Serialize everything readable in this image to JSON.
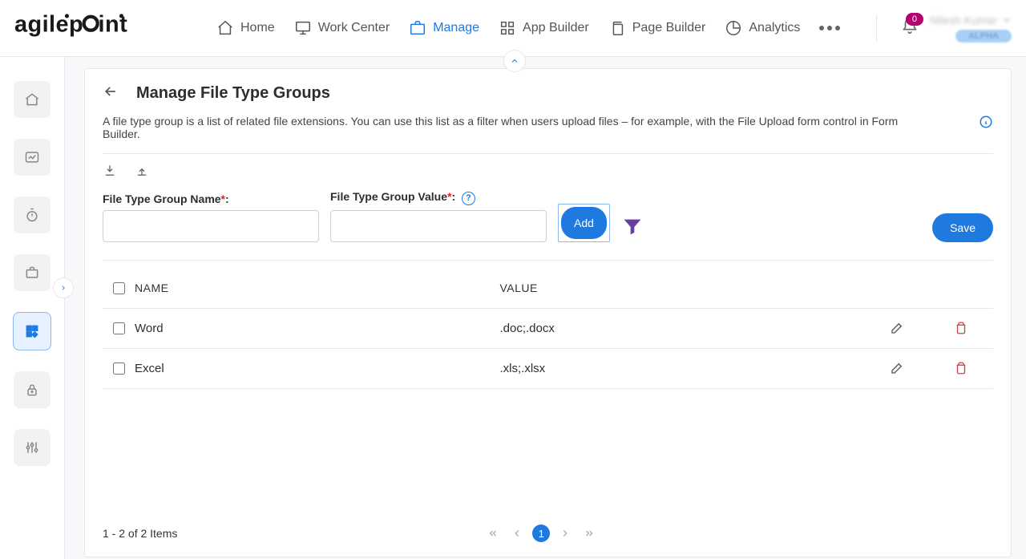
{
  "brand": "agilepoint",
  "nav": {
    "home": "Home",
    "work_center": "Work Center",
    "manage": "Manage",
    "app_builder": "App Builder",
    "page_builder": "Page Builder",
    "analytics": "Analytics",
    "active": "manage"
  },
  "notifications": {
    "count": "0"
  },
  "user": {
    "name": "Nilesh Kumar",
    "badge": "ALPHA"
  },
  "page": {
    "title": "Manage File Type Groups",
    "description": "A file type group is a list of related file extensions. You can use this list as a filter when users upload files – for example, with the File Upload form control in Form Builder."
  },
  "form": {
    "name_label": "File Type Group Name",
    "value_label": "File Type Group Value",
    "required_suffix": "*",
    "colon": ":",
    "help_char": "?",
    "add_button": "Add",
    "save_button": "Save",
    "name_value": "",
    "value_value": ""
  },
  "table": {
    "columns": {
      "name": "NAME",
      "value": "VALUE"
    },
    "rows": [
      {
        "name": "Word",
        "value": ".doc;.docx"
      },
      {
        "name": "Excel",
        "value": ".xls;.xlsx"
      }
    ]
  },
  "pager": {
    "info": "1 - 2 of 2 Items",
    "current": "1"
  }
}
